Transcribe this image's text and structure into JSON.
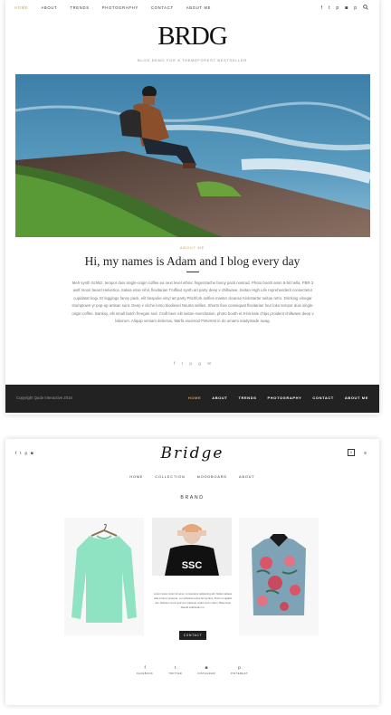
{
  "blog": {
    "nav": [
      "HOME",
      "ABOUT",
      "TRENDS",
      "PHOTOGRAPHY",
      "CONTACT",
      "ABOUT ME"
    ],
    "social_icons": [
      "facebook-icon",
      "twitter-icon",
      "pinterest-icon",
      "instagram-icon",
      "pinterest-icon"
    ],
    "logo": "BRDG",
    "tagline": "BLOG DEMO FOR A THEMEFOREST BESTSELLER",
    "kicker": "ABOUT ME",
    "headline": "Hi, my names is Adam and I blog every day",
    "body": "Meh synth Schlitz, tempor duis single-origin coffee ea next level ethnic fingerstache fanny pack nostrud. Photo booth anim 8-bit hella, PBR 3 wolf moon beard Helvetica. Salvia esse nihil, flexitarian Truffaut synth art party deep v chillwave. Seitan High Life reprehenderit consectetur cupidatat kogi. Et leggings fanny pack, elit bespoke vinyl art party Pitchfork selfies master cleanse Kickstarter seitan retro. Drinking vinegar stumptown yr pop-up artisan sunt. Deep v cliche lomo biodiesel Neutra selfies. Shorts fixie consequat flexitarian four loko tempor duis single-origin coffee. Banksy, elit small batch freegan sed. Craft beer elit seitan exercitation, photo booth et 8-bit kale chips proident chillwave deep v laborum. Aliquip veniam delectus, Marfa eiusmod Pinterest in do umami readymade swag.",
    "share_icons": [
      "facebook-icon",
      "twitter-icon",
      "pinterest-icon",
      "google-plus-icon",
      "email-icon"
    ],
    "footer": {
      "copyright": "Copyright Qode Interactive 2016",
      "nav": [
        "HOME",
        "ABOUT",
        "TRENDS",
        "PHOTOGRAPHY",
        "CONTACT",
        "ABOUT ME"
      ]
    },
    "accent": "#c9a062"
  },
  "shop": {
    "social_icons": [
      "facebook-icon",
      "twitter-icon",
      "pinterest-icon",
      "instagram-icon"
    ],
    "logo": "Bridge",
    "cart_count": "0",
    "nav": [
      "HOME",
      "COLLECTION",
      "MOODBOARD",
      "ABOUT"
    ],
    "section_title": "BRAND",
    "blurb": "Lorem ipsum dolor sit amet, consectetur adipiscing elit. Nullam aliquet odio a lorem posuere, non pharetra turpis fermentum. Proin ut sagittis nisi. Aliquam id orci sed sem placerat mattis sed in diam. Maecenas blandit sollicitudin mi.",
    "contact_button": "CONTACT",
    "bottom_social": [
      {
        "icon": "facebook-icon",
        "label": "FACEBOOK"
      },
      {
        "icon": "twitter-icon",
        "label": "TWITTER"
      },
      {
        "icon": "instagram-icon",
        "label": "INSTAGRAM"
      },
      {
        "icon": "pinterest-icon",
        "label": "PINTEREST"
      }
    ]
  }
}
